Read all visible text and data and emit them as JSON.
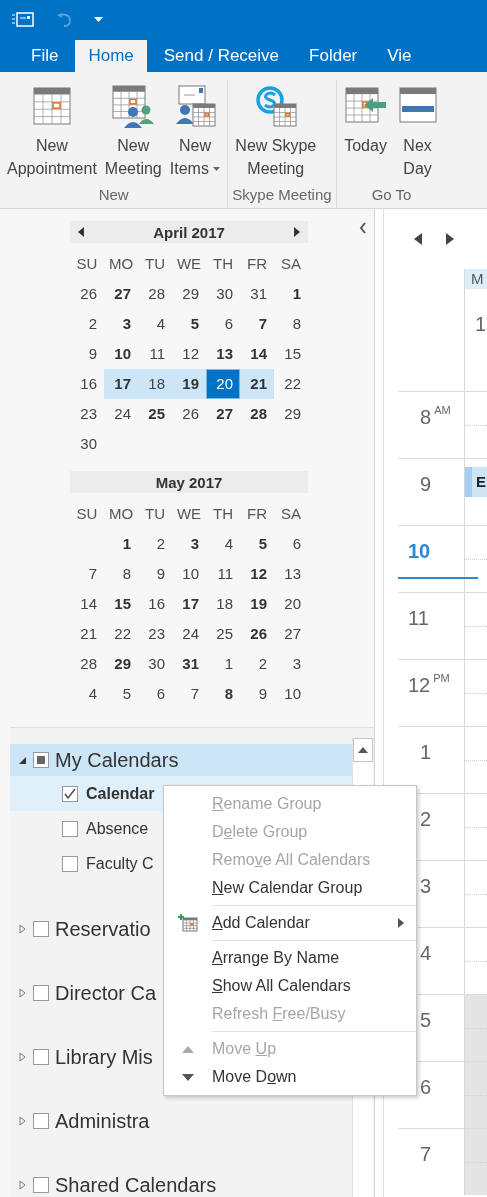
{
  "quick_access": {
    "undo_disabled": true
  },
  "tabs": [
    {
      "label": "File",
      "selected": false
    },
    {
      "label": "Home",
      "selected": true
    },
    {
      "label": "Send / Receive",
      "selected": false
    },
    {
      "label": "Folder",
      "selected": false
    },
    {
      "label": "Vie",
      "selected": false
    }
  ],
  "ribbon": {
    "groups": [
      {
        "label": "New",
        "buttons": [
          {
            "lines": [
              "New",
              "Appointment"
            ],
            "dropdown": false
          },
          {
            "lines": [
              "New",
              "Meeting"
            ],
            "dropdown": false
          },
          {
            "lines": [
              "New",
              "Items"
            ],
            "dropdown": true
          }
        ]
      },
      {
        "label": "Skype Meeting",
        "buttons": [
          {
            "lines": [
              "New Skype",
              "Meeting"
            ],
            "dropdown": false
          }
        ]
      },
      {
        "label": "Go To",
        "buttons": [
          {
            "lines": [
              "Today"
            ],
            "dropdown": false
          },
          {
            "lines": [
              "Nex",
              "Day"
            ],
            "dropdown": false
          }
        ]
      }
    ]
  },
  "months": [
    {
      "title": "April 2017",
      "nav_arrows": true,
      "weekdays": [
        "SU",
        "MO",
        "TU",
        "WE",
        "TH",
        "FR",
        "SA"
      ],
      "weeks": [
        [
          {
            "d": "26",
            "bold": false,
            "selected": false,
            "today": false
          },
          {
            "d": "27",
            "bold": true,
            "selected": false,
            "today": false
          },
          {
            "d": "28",
            "bold": false,
            "selected": false,
            "today": false
          },
          {
            "d": "29",
            "bold": false,
            "selected": false,
            "today": false
          },
          {
            "d": "30",
            "bold": false,
            "selected": false,
            "today": false
          },
          {
            "d": "31",
            "bold": false,
            "selected": false,
            "today": false
          },
          {
            "d": "1",
            "bold": true,
            "selected": false,
            "today": false
          }
        ],
        [
          {
            "d": "2",
            "bold": false,
            "selected": false,
            "today": false
          },
          {
            "d": "3",
            "bold": true,
            "selected": false,
            "today": false
          },
          {
            "d": "4",
            "bold": false,
            "selected": false,
            "today": false
          },
          {
            "d": "5",
            "bold": true,
            "selected": false,
            "today": false
          },
          {
            "d": "6",
            "bold": false,
            "selected": false,
            "today": false
          },
          {
            "d": "7",
            "bold": true,
            "selected": false,
            "today": false
          },
          {
            "d": "8",
            "bold": false,
            "selected": false,
            "today": false
          }
        ],
        [
          {
            "d": "9",
            "bold": false,
            "selected": false,
            "today": false
          },
          {
            "d": "10",
            "bold": true,
            "selected": false,
            "today": false
          },
          {
            "d": "11",
            "bold": false,
            "selected": false,
            "today": false
          },
          {
            "d": "12",
            "bold": false,
            "selected": false,
            "today": false
          },
          {
            "d": "13",
            "bold": true,
            "selected": false,
            "today": false
          },
          {
            "d": "14",
            "bold": true,
            "selected": false,
            "today": false
          },
          {
            "d": "15",
            "bold": false,
            "selected": false,
            "today": false
          }
        ],
        [
          {
            "d": "16",
            "bold": false,
            "selected": false,
            "today": false
          },
          {
            "d": "17",
            "bold": true,
            "selected": true,
            "today": false
          },
          {
            "d": "18",
            "bold": false,
            "selected": true,
            "today": false
          },
          {
            "d": "19",
            "bold": true,
            "selected": true,
            "today": false
          },
          {
            "d": "20",
            "bold": false,
            "selected": true,
            "today": true
          },
          {
            "d": "21",
            "bold": true,
            "selected": true,
            "today": false
          },
          {
            "d": "22",
            "bold": false,
            "selected": false,
            "today": false
          }
        ],
        [
          {
            "d": "23",
            "bold": false,
            "selected": false,
            "today": false
          },
          {
            "d": "24",
            "bold": false,
            "selected": false,
            "today": false
          },
          {
            "d": "25",
            "bold": true,
            "selected": false,
            "today": false
          },
          {
            "d": "26",
            "bold": false,
            "selected": false,
            "today": false
          },
          {
            "d": "27",
            "bold": true,
            "selected": false,
            "today": false
          },
          {
            "d": "28",
            "bold": true,
            "selected": false,
            "today": false
          },
          {
            "d": "29",
            "bold": false,
            "selected": false,
            "today": false
          }
        ],
        [
          {
            "d": "30",
            "bold": false,
            "selected": false,
            "today": false
          }
        ]
      ]
    },
    {
      "title": "May 2017",
      "nav_arrows": false,
      "weekdays": [
        "SU",
        "MO",
        "TU",
        "WE",
        "TH",
        "FR",
        "SA"
      ],
      "weeks": [
        [
          {
            "d": "1",
            "bold": true,
            "selected": false,
            "today": false
          },
          {
            "d": "2",
            "bold": false,
            "selected": false,
            "today": false
          },
          {
            "d": "3",
            "bold": true,
            "selected": false,
            "today": false
          },
          {
            "d": "4",
            "bold": false,
            "selected": false,
            "today": false
          },
          {
            "d": "5",
            "bold": true,
            "selected": false,
            "today": false
          },
          {
            "d": "6",
            "bold": false,
            "selected": false,
            "today": false
          }
        ],
        [
          {
            "d": "7",
            "bold": false,
            "selected": false,
            "today": false
          },
          {
            "d": "8",
            "bold": false,
            "selected": false,
            "today": false
          },
          {
            "d": "9",
            "bold": false,
            "selected": false,
            "today": false
          },
          {
            "d": "10",
            "bold": false,
            "selected": false,
            "today": false
          },
          {
            "d": "11",
            "bold": false,
            "selected": false,
            "today": false
          },
          {
            "d": "12",
            "bold": true,
            "selected": false,
            "today": false
          },
          {
            "d": "13",
            "bold": false,
            "selected": false,
            "today": false
          }
        ],
        [
          {
            "d": "14",
            "bold": false,
            "selected": false,
            "today": false
          },
          {
            "d": "15",
            "bold": true,
            "selected": false,
            "today": false
          },
          {
            "d": "16",
            "bold": false,
            "selected": false,
            "today": false
          },
          {
            "d": "17",
            "bold": true,
            "selected": false,
            "today": false
          },
          {
            "d": "18",
            "bold": false,
            "selected": false,
            "today": false
          },
          {
            "d": "19",
            "bold": true,
            "selected": false,
            "today": false
          },
          {
            "d": "20",
            "bold": false,
            "selected": false,
            "today": false
          }
        ],
        [
          {
            "d": "21",
            "bold": false,
            "selected": false,
            "today": false
          },
          {
            "d": "22",
            "bold": false,
            "selected": false,
            "today": false
          },
          {
            "d": "23",
            "bold": false,
            "selected": false,
            "today": false
          },
          {
            "d": "24",
            "bold": false,
            "selected": false,
            "today": false
          },
          {
            "d": "25",
            "bold": false,
            "selected": false,
            "today": false
          },
          {
            "d": "26",
            "bold": true,
            "selected": false,
            "today": false
          },
          {
            "d": "27",
            "bold": false,
            "selected": false,
            "today": false
          }
        ],
        [
          {
            "d": "28",
            "bold": false,
            "selected": false,
            "today": false
          },
          {
            "d": "29",
            "bold": true,
            "selected": false,
            "today": false
          },
          {
            "d": "30",
            "bold": false,
            "selected": false,
            "today": false
          },
          {
            "d": "31",
            "bold": true,
            "selected": false,
            "today": false
          },
          {
            "d": "1",
            "bold": false,
            "selected": false,
            "today": false
          },
          {
            "d": "2",
            "bold": false,
            "selected": false,
            "today": false
          },
          {
            "d": "3",
            "bold": false,
            "selected": false,
            "today": false
          }
        ],
        [
          {
            "d": "4",
            "bold": false,
            "selected": false,
            "today": false
          },
          {
            "d": "5",
            "bold": false,
            "selected": false,
            "today": false
          },
          {
            "d": "6",
            "bold": false,
            "selected": false,
            "today": false
          },
          {
            "d": "7",
            "bold": false,
            "selected": false,
            "today": false
          },
          {
            "d": "8",
            "bold": true,
            "selected": false,
            "today": false
          },
          {
            "d": "9",
            "bold": false,
            "selected": false,
            "today": false
          },
          {
            "d": "10",
            "bold": false,
            "selected": false,
            "today": false
          }
        ]
      ]
    }
  ],
  "calendar_groups": [
    {
      "label": "My Calendars",
      "expanded": true,
      "checked": false,
      "partial": true,
      "selected": true,
      "children": [
        {
          "label": "Calendar",
          "checked": true,
          "selected": true
        },
        {
          "label": "Absence",
          "checked": false,
          "selected": false
        },
        {
          "label": "Faculty C",
          "checked": false,
          "selected": false
        }
      ]
    },
    {
      "label": "Reservatio",
      "expanded": false,
      "checked": false,
      "partial": false,
      "selected": false
    },
    {
      "label": "Director Ca",
      "expanded": false,
      "checked": false,
      "partial": false,
      "selected": false
    },
    {
      "label": "Library Mis",
      "expanded": false,
      "checked": false,
      "partial": false,
      "selected": false
    },
    {
      "label": "Administra",
      "expanded": false,
      "checked": false,
      "partial": false,
      "selected": false
    },
    {
      "label": "Shared Calendars",
      "expanded": false,
      "checked": false,
      "partial": false,
      "selected": false
    }
  ],
  "context_menu": [
    {
      "kind": "item",
      "key": "R",
      "after": "ename Group",
      "disabled": true,
      "submenu": false
    },
    {
      "kind": "item",
      "before": "D",
      "key": "e",
      "after": "lete Group",
      "disabled": true,
      "submenu": false
    },
    {
      "kind": "item",
      "before": "Remo",
      "key": "v",
      "after": "e All Calendars",
      "disabled": true,
      "submenu": false
    },
    {
      "kind": "item",
      "key": "N",
      "after": "ew Calendar Group",
      "disabled": false,
      "submenu": false
    },
    {
      "kind": "separator"
    },
    {
      "kind": "item",
      "key": "A",
      "after": "dd Calendar",
      "disabled": false,
      "submenu": true
    },
    {
      "kind": "separator"
    },
    {
      "kind": "item",
      "key": "A",
      "after": "rrange By Name",
      "disabled": false,
      "submenu": false
    },
    {
      "kind": "item",
      "key": "S",
      "after": "how All Calendars",
      "disabled": false,
      "submenu": false
    },
    {
      "kind": "item",
      "before": "Refresh ",
      "key": "F",
      "after": "ree/Busy",
      "disabled": true,
      "submenu": false
    },
    {
      "kind": "separator"
    },
    {
      "kind": "item",
      "before": "Move ",
      "key": "U",
      "after": "p",
      "disabled": true,
      "submenu": false
    },
    {
      "kind": "item",
      "before": "Move D",
      "key": "o",
      "after": "wn",
      "disabled": false,
      "submenu": false
    }
  ],
  "day_column": {
    "header": "M",
    "date": "1"
  },
  "hours": [
    {
      "label": "8",
      "suffix": "AM",
      "current": false,
      "off_hours": false
    },
    {
      "label": "9",
      "current": false,
      "off_hours": false,
      "event_title": "E"
    },
    {
      "label": "10",
      "current": true,
      "off_hours": false
    },
    {
      "label": "11",
      "current": false,
      "off_hours": false
    },
    {
      "label": "12",
      "suffix": "PM",
      "current": false,
      "off_hours": false
    },
    {
      "label": "1",
      "current": false,
      "off_hours": false
    },
    {
      "label": "2",
      "current": false,
      "off_hours": false
    },
    {
      "label": "3",
      "current": false,
      "off_hours": false
    },
    {
      "label": "4",
      "current": false,
      "off_hours": false
    },
    {
      "label": "5",
      "current": false,
      "off_hours": true
    },
    {
      "label": "6",
      "current": false,
      "off_hours": true
    },
    {
      "label": "7",
      "current": false,
      "off_hours": true
    }
  ]
}
